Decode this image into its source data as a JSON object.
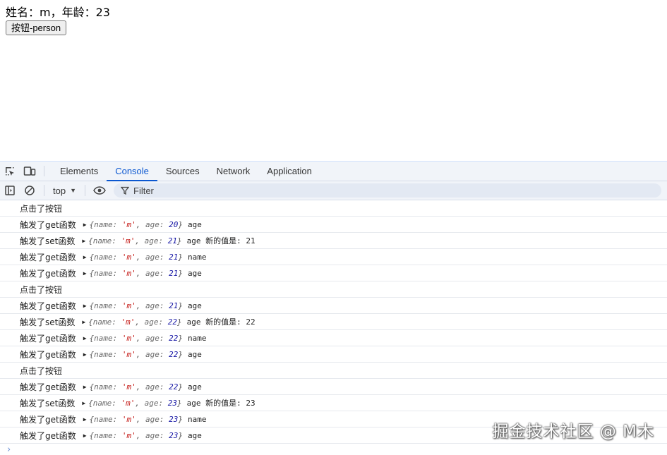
{
  "page": {
    "info_label": "姓名：",
    "name_value": "m",
    "age_label": "，年龄：",
    "age_value": "23",
    "button_label": "按钮-person"
  },
  "devtools": {
    "tabs": [
      {
        "label": "Elements",
        "active": false
      },
      {
        "label": "Console",
        "active": true
      },
      {
        "label": "Sources",
        "active": false
      },
      {
        "label": "Network",
        "active": false
      },
      {
        "label": "Application",
        "active": false
      }
    ],
    "context": "top",
    "filter_placeholder": "Filter",
    "accent_color": "#0b57d0"
  },
  "console": {
    "rows": [
      {
        "label": "点击了按钮",
        "obj": null
      },
      {
        "label": "触发了get函数",
        "obj": {
          "name": "'m'",
          "age": "20"
        },
        "after": "age"
      },
      {
        "label": "触发了set函数",
        "obj": {
          "name": "'m'",
          "age": "21"
        },
        "after": "age 新的值是: 21"
      },
      {
        "label": "触发了get函数",
        "obj": {
          "name": "'m'",
          "age": "21"
        },
        "after": "name"
      },
      {
        "label": "触发了get函数",
        "obj": {
          "name": "'m'",
          "age": "21"
        },
        "after": "age"
      },
      {
        "label": "点击了按钮",
        "obj": null
      },
      {
        "label": "触发了get函数",
        "obj": {
          "name": "'m'",
          "age": "21"
        },
        "after": "age"
      },
      {
        "label": "触发了set函数",
        "obj": {
          "name": "'m'",
          "age": "22"
        },
        "after": "age 新的值是: 22"
      },
      {
        "label": "触发了get函数",
        "obj": {
          "name": "'m'",
          "age": "22"
        },
        "after": "name"
      },
      {
        "label": "触发了get函数",
        "obj": {
          "name": "'m'",
          "age": "22"
        },
        "after": "age"
      },
      {
        "label": "点击了按钮",
        "obj": null
      },
      {
        "label": "触发了get函数",
        "obj": {
          "name": "'m'",
          "age": "22"
        },
        "after": "age"
      },
      {
        "label": "触发了set函数",
        "obj": {
          "name": "'m'",
          "age": "23"
        },
        "after": "age 新的值是: 23"
      },
      {
        "label": "触发了get函数",
        "obj": {
          "name": "'m'",
          "age": "23"
        },
        "after": "name"
      },
      {
        "label": "触发了get函数",
        "obj": {
          "name": "'m'",
          "age": "23"
        },
        "after": "age"
      }
    ],
    "prompt": "›"
  },
  "watermark": "掘金技术社区 @ M木"
}
